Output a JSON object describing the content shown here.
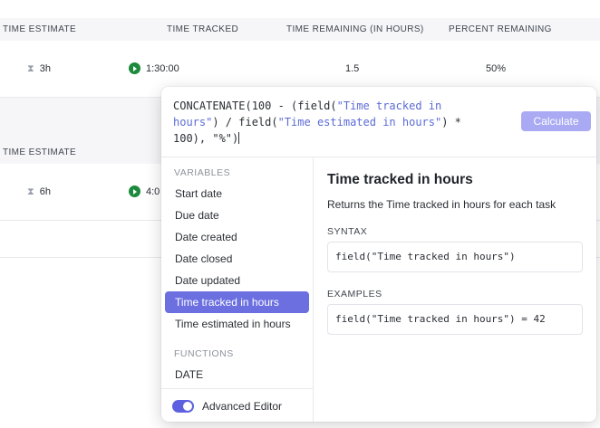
{
  "table": {
    "group1": {
      "headers": {
        "time_estimate": "TIME ESTIMATE",
        "time_tracked": "TIME TRACKED",
        "time_remaining": "TIME REMAINING (IN HOURS)",
        "percent_remaining": "PERCENT REMAINING"
      },
      "row": {
        "estimate": "3h",
        "tracked": "1:30:00",
        "remaining": "1.5",
        "percent": "50%"
      }
    },
    "group2": {
      "headers": {
        "time_estimate": "TIME ESTIMATE"
      },
      "row": {
        "estimate": "6h",
        "tracked": "4:0"
      }
    }
  },
  "popup": {
    "formula": {
      "p1": "CONCATENATE(100 - (field(",
      "s1": "\"Time tracked in hours\"",
      "p2": ") / field(",
      "s2": "\"Time estimated in hours\"",
      "p3": ") * 100), \"%\")"
    },
    "calculate_label": "Calculate",
    "variables_label": "VARIABLES",
    "variables": [
      {
        "label": "Start date",
        "active": false
      },
      {
        "label": "Due date",
        "active": false
      },
      {
        "label": "Date created",
        "active": false
      },
      {
        "label": "Date closed",
        "active": false
      },
      {
        "label": "Date updated",
        "active": false
      },
      {
        "label": "Time tracked in hours",
        "active": true
      },
      {
        "label": "Time estimated in hours",
        "active": false
      }
    ],
    "functions_label": "FUNCTIONS",
    "functions": [
      {
        "label": "DATE"
      }
    ],
    "advanced_editor_label": "Advanced Editor",
    "advanced_editor_on": true,
    "doc": {
      "title": "Time tracked in hours",
      "description": "Returns the Time tracked in hours for each task",
      "syntax_label": "SYNTAX",
      "syntax": "field(\"Time tracked in hours\")",
      "examples_label": "EXAMPLES",
      "example": "field(\"Time tracked in hours\") = 42"
    }
  },
  "colors": {
    "accent": "#6b6fe0",
    "calculate_button": "#a9aaf3",
    "play_green": "#1c8a3c",
    "formula_string": "#5b6bd6"
  },
  "icons": {
    "estimate": "hourglass-icon",
    "tracked": "play-icon"
  }
}
